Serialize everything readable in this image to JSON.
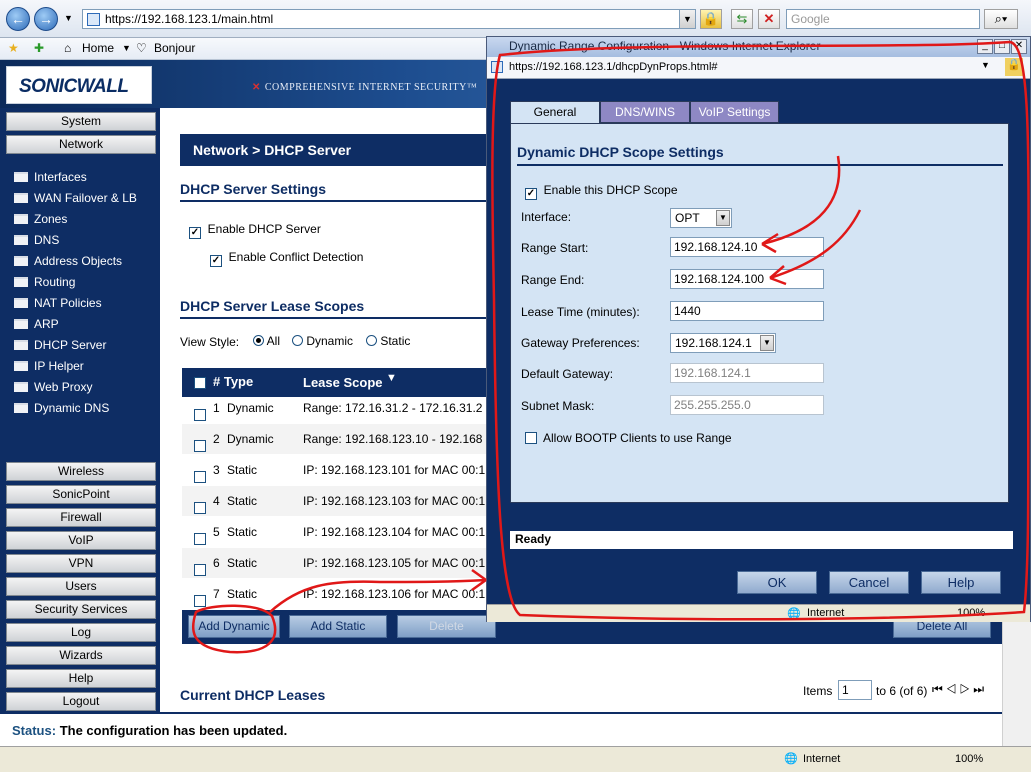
{
  "browser": {
    "url": "https://192.168.123.1/main.html",
    "search_placeholder": "Google",
    "favorites": [
      "Home",
      "Bonjour"
    ]
  },
  "banner": {
    "logo": "SONICWALL",
    "tagline": "COMPREHENSIVE INTERNET SECURITY™"
  },
  "sidebar": {
    "top_buttons": [
      "System",
      "Network"
    ],
    "items": [
      "Interfaces",
      "WAN Failover & LB",
      "Zones",
      "DNS",
      "Address Objects",
      "Routing",
      "NAT Policies",
      "ARP",
      "DHCP Server",
      "IP Helper",
      "Web Proxy",
      "Dynamic DNS"
    ],
    "bottom_buttons": [
      "Wireless",
      "SonicPoint",
      "Firewall",
      "VoIP",
      "VPN",
      "Users",
      "Security Services",
      "Log",
      "Wizards",
      "Help",
      "Logout"
    ]
  },
  "main": {
    "page_title": "Network > DHCP Server",
    "settings_title": "DHCP Server Settings",
    "enable_dhcp": "Enable DHCP Server",
    "enable_conflict": "Enable Conflict Detection",
    "lease_title": "DHCP Server Lease Scopes",
    "view_style": "View Style:",
    "view_all": "All",
    "view_dynamic": "Dynamic",
    "view_static": "Static",
    "col_num_type": "# Type",
    "col_scope": "Lease Scope",
    "rows": [
      {
        "num": "1",
        "type": "Dynamic",
        "scope": "Range: 172.16.31.2 - 172.16.31.2"
      },
      {
        "num": "2",
        "type": "Dynamic",
        "scope": "Range: 192.168.123.10 - 192.168"
      },
      {
        "num": "3",
        "type": "Static",
        "scope": "IP: 192.168.123.101 for MAC 00:1"
      },
      {
        "num": "4",
        "type": "Static",
        "scope": "IP: 192.168.123.103 for MAC 00:1"
      },
      {
        "num": "5",
        "type": "Static",
        "scope": "IP: 192.168.123.104 for MAC 00:1"
      },
      {
        "num": "6",
        "type": "Static",
        "scope": "IP: 192.168.123.105 for MAC 00:1"
      },
      {
        "num": "7",
        "type": "Static",
        "scope": "IP: 192.168.123.106 for MAC 00:1"
      }
    ],
    "btn_add_dynamic": "Add Dynamic",
    "btn_add_static": "Add Static",
    "btn_delete": "Delete",
    "btn_delete_all": "Delete All",
    "leases_title": "Current DHCP Leases",
    "items_label": "Items",
    "items_value": "1",
    "items_range": "to 6 (of 6)"
  },
  "status": {
    "label": "Status:",
    "text": "The configuration has been updated."
  },
  "browser_status": {
    "zone": "Internet",
    "zoom": "100%"
  },
  "popup": {
    "title": "Dynamic Range Configuration - Windows Internet Explorer",
    "url": "https://192.168.123.1/dhcpDynProps.html#",
    "tabs": [
      "General",
      "DNS/WINS",
      "VoIP Settings"
    ],
    "heading": "Dynamic DHCP Scope Settings",
    "enable_scope": "Enable this DHCP Scope",
    "interface_label": "Interface:",
    "interface_value": "OPT",
    "range_start_label": "Range Start:",
    "range_start_value": "192.168.124.10",
    "range_end_label": "Range End:",
    "range_end_value": "192.168.124.100",
    "lease_time_label": "Lease Time (minutes):",
    "lease_time_value": "1440",
    "gateway_pref_label": "Gateway Preferences:",
    "gateway_pref_value": "192.168.124.1",
    "default_gateway_label": "Default Gateway:",
    "default_gateway_value": "192.168.124.1",
    "subnet_label": "Subnet Mask:",
    "subnet_value": "255.255.255.0",
    "bootp": "Allow BOOTP Clients to use Range",
    "ready": "Ready",
    "ok": "OK",
    "cancel": "Cancel",
    "help": "Help",
    "zone": "Internet",
    "zoom": "100%"
  },
  "colors": {
    "navy": "#0e2d64",
    "annotation": "#e01818",
    "panel": "#d4e4f4"
  }
}
